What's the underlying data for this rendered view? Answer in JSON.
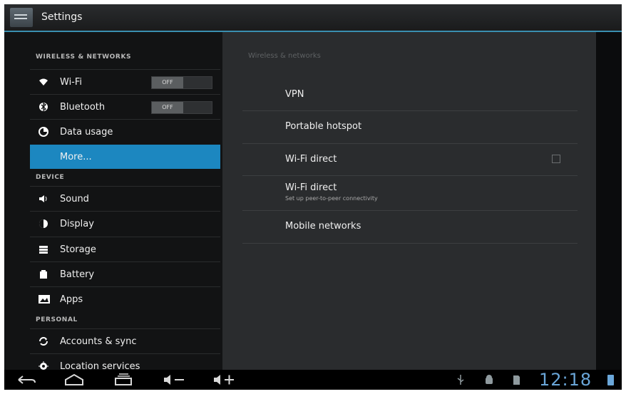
{
  "actionbar": {
    "title": "Settings",
    "icon": "settings-icon"
  },
  "left_pane": {
    "sections": [
      {
        "header": "WIRELESS & NETWORKS",
        "items": [
          {
            "label": "Wi-Fi",
            "icon": "wifi-icon",
            "toggle": "OFF"
          },
          {
            "label": "Bluetooth",
            "icon": "bluetooth-icon",
            "toggle": "OFF"
          },
          {
            "label": "Data usage",
            "icon": "data-usage-icon"
          },
          {
            "label": "More...",
            "selected": true
          }
        ]
      },
      {
        "header": "DEVICE",
        "items": [
          {
            "label": "Sound",
            "icon": "sound-icon"
          },
          {
            "label": "Display",
            "icon": "display-icon"
          },
          {
            "label": "Storage",
            "icon": "storage-icon"
          },
          {
            "label": "Battery",
            "icon": "battery-icon"
          },
          {
            "label": "Apps",
            "icon": "apps-icon"
          }
        ]
      },
      {
        "header": "PERSONAL",
        "items": [
          {
            "label": "Accounts & sync",
            "icon": "sync-icon"
          },
          {
            "label": "Location services",
            "icon": "location-icon"
          }
        ]
      }
    ]
  },
  "right_pane": {
    "header": "Wireless & networks",
    "items": [
      {
        "label": "VPN"
      },
      {
        "label": "Portable hotspot"
      },
      {
        "label": "Wi-Fi direct",
        "checkbox": false
      },
      {
        "label": "Wi-Fi direct",
        "subtitle": "Set up peer-to-peer connectivity"
      },
      {
        "label": "Mobile networks"
      }
    ]
  },
  "navbar": {
    "buttons": [
      "back-icon",
      "home-icon",
      "recent-apps-icon",
      "volume-down-icon",
      "volume-up-icon"
    ],
    "status_icons": [
      "usb-icon",
      "android-debug-icon",
      "sd-card-icon"
    ],
    "clock": "12:18",
    "battery": "battery-status-icon",
    "accent_color": "#6aa6d8"
  },
  "colors": {
    "selected": "#1c87c0",
    "divider_accent": "#3a8fb0"
  }
}
